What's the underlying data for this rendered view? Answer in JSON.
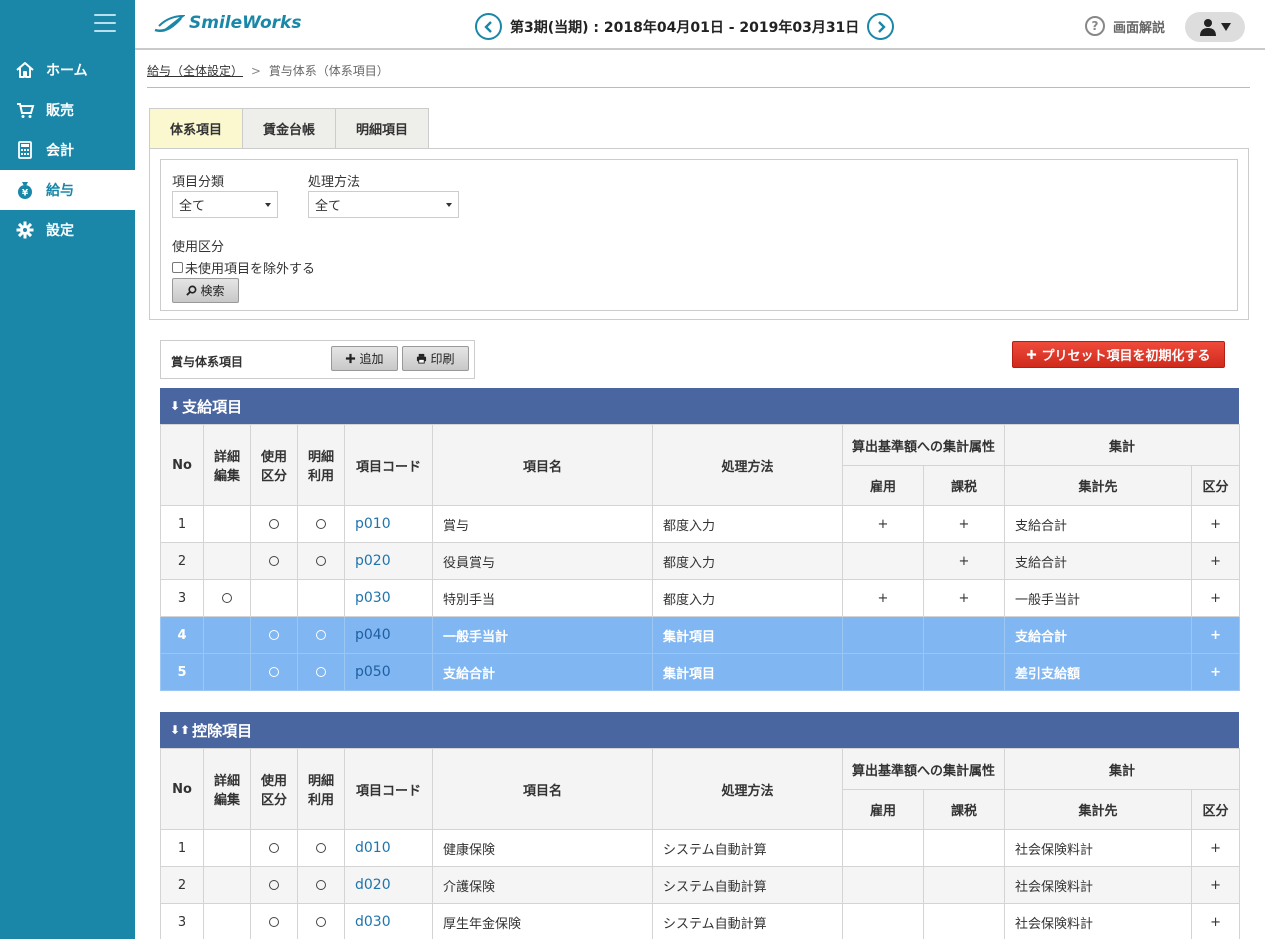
{
  "app": {
    "logo_text": "SmileWorks"
  },
  "sidebar": {
    "items": [
      {
        "label": "ホーム",
        "icon": "home-icon"
      },
      {
        "label": "販売",
        "icon": "cart-icon"
      },
      {
        "label": "会計",
        "icon": "calculator-icon"
      },
      {
        "label": "給与",
        "icon": "money-bag-icon",
        "active": true
      },
      {
        "label": "設定",
        "icon": "gear-icon"
      }
    ]
  },
  "header": {
    "period": "第3期(当期) : 2018年04月01日 - 2019年03月31日",
    "help_label": "画面解説"
  },
  "breadcrumb": {
    "parent": "給与（全体設定）",
    "separator": ">",
    "current": "賞与体系（体系項目）"
  },
  "tabs": [
    {
      "label": "体系項目",
      "active": true
    },
    {
      "label": "賃金台帳"
    },
    {
      "label": "明細項目"
    }
  ],
  "search": {
    "category_label": "項目分類",
    "category_value": "全て",
    "method_label": "処理方法",
    "method_value": "全て",
    "usage_label": "使用区分",
    "exclude_label": "未使用項目を除外する",
    "search_button": "検索"
  },
  "bonus": {
    "title": "賞与体系項目",
    "add_button": "追加",
    "print_button": "印刷",
    "reset_button": "プリセット項目を初期化する"
  },
  "columns": {
    "no": "No",
    "detail_edit_1": "詳細",
    "detail_edit_2": "編集",
    "usage_1": "使用",
    "usage_2": "区分",
    "detail_use_1": "明細",
    "detail_use_2": "利用",
    "code": "項目コード",
    "name": "項目名",
    "method": "処理方法",
    "base_attr": "算出基準額への集計属性",
    "employment": "雇用",
    "tax": "課税",
    "total": "集計",
    "total_target": "集計先",
    "division": "区分"
  },
  "payments": {
    "title": "支給項目",
    "rows": [
      {
        "no": "1",
        "detail": "",
        "usage": "○",
        "meisai": "○",
        "code": "p010",
        "name": "賞与",
        "method": "都度入力",
        "employment": "+",
        "tax": "+",
        "target": "支給合計",
        "division": "+"
      },
      {
        "no": "2",
        "detail": "",
        "usage": "○",
        "meisai": "○",
        "code": "p020",
        "name": "役員賞与",
        "method": "都度入力",
        "employment": "",
        "tax": "+",
        "target": "支給合計",
        "division": "+"
      },
      {
        "no": "3",
        "detail": "○",
        "usage": "",
        "meisai": "",
        "code": "p030",
        "name": "特別手当",
        "method": "都度入力",
        "employment": "+",
        "tax": "+",
        "target": "一般手当計",
        "division": "+"
      },
      {
        "no": "4",
        "detail": "",
        "usage": "○",
        "meisai": "○",
        "code": "p040",
        "name": "一般手当計",
        "method": "集計項目",
        "employment": "",
        "tax": "",
        "target": "支給合計",
        "division": "+"
      },
      {
        "no": "5",
        "detail": "",
        "usage": "○",
        "meisai": "○",
        "code": "p050",
        "name": "支給合計",
        "method": "集計項目",
        "employment": "",
        "tax": "",
        "target": "差引支給額",
        "division": "+"
      }
    ]
  },
  "deductions": {
    "title": "控除項目",
    "rows": [
      {
        "no": "1",
        "detail": "",
        "usage": "○",
        "meisai": "○",
        "code": "d010",
        "name": "健康保険",
        "method": "システム自動計算",
        "employment": "",
        "tax": "",
        "target": "社会保険料計",
        "division": "+"
      },
      {
        "no": "2",
        "detail": "",
        "usage": "○",
        "meisai": "○",
        "code": "d020",
        "name": "介護保険",
        "method": "システム自動計算",
        "employment": "",
        "tax": "",
        "target": "社会保険料計",
        "division": "+"
      },
      {
        "no": "3",
        "detail": "",
        "usage": "○",
        "meisai": "○",
        "code": "d030",
        "name": "厚生年金保険",
        "method": "システム自動計算",
        "employment": "",
        "tax": "",
        "target": "社会保険料計",
        "division": "+"
      }
    ]
  },
  "colors": {
    "sidebar": "#1a87a8",
    "section_header": "#4a66a0",
    "highlight_row": "#80b6f1",
    "reset_button": "#d9301f"
  }
}
